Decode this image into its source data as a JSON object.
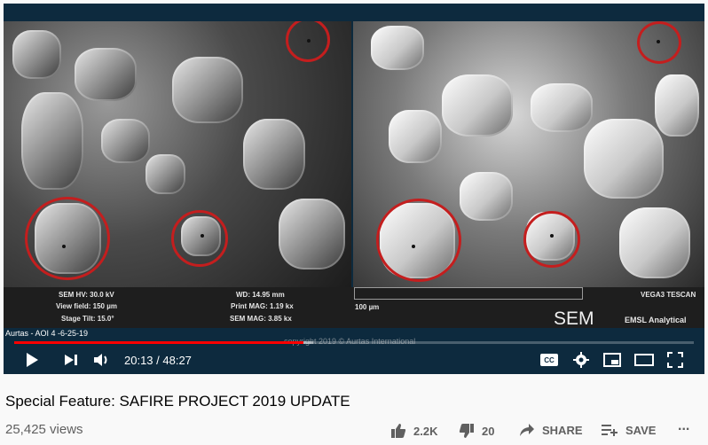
{
  "video": {
    "sem_info": {
      "hv": "SEM HV: 30.0 kV",
      "view_field": "View field: 150 µm",
      "stage_tilt": "Stage Tilt: 15.0°",
      "wd": "WD: 14.95 mm",
      "print_mag": "Print MAG: 1.19 kx",
      "sem_mag": "SEM MAG: 3.85 kx",
      "instrument": "VEGA3 TESCAN",
      "scale": "100 µm",
      "sem_label": "SEM",
      "lab": "EMSL Analytical",
      "sample_caption": "Aurtas - AOI 4 -6-25-19",
      "watermark": "copyright 2019 © Aurtas International"
    },
    "progress": {
      "played_fraction": 0.426,
      "buffered_fraction": 0.44
    },
    "time": "20:13 / 48:27"
  },
  "controls": {
    "icons": [
      "play-icon",
      "next-icon",
      "volume-icon",
      "captions-icon",
      "settings-icon",
      "miniplayer-icon",
      "theater-icon",
      "fullscreen-icon"
    ],
    "cc_label": "CC"
  },
  "meta": {
    "title": "Special Feature: SAFIRE PROJECT 2019 UPDATE",
    "views": "25,425 views",
    "likes": "2.2K",
    "dislikes": "20",
    "share_label": "SHARE",
    "save_label": "SAVE",
    "more": "..."
  },
  "colors": {
    "progress": "#ff0000",
    "circle": "#c41e1e",
    "text": "#030303",
    "muted": "#606060"
  }
}
